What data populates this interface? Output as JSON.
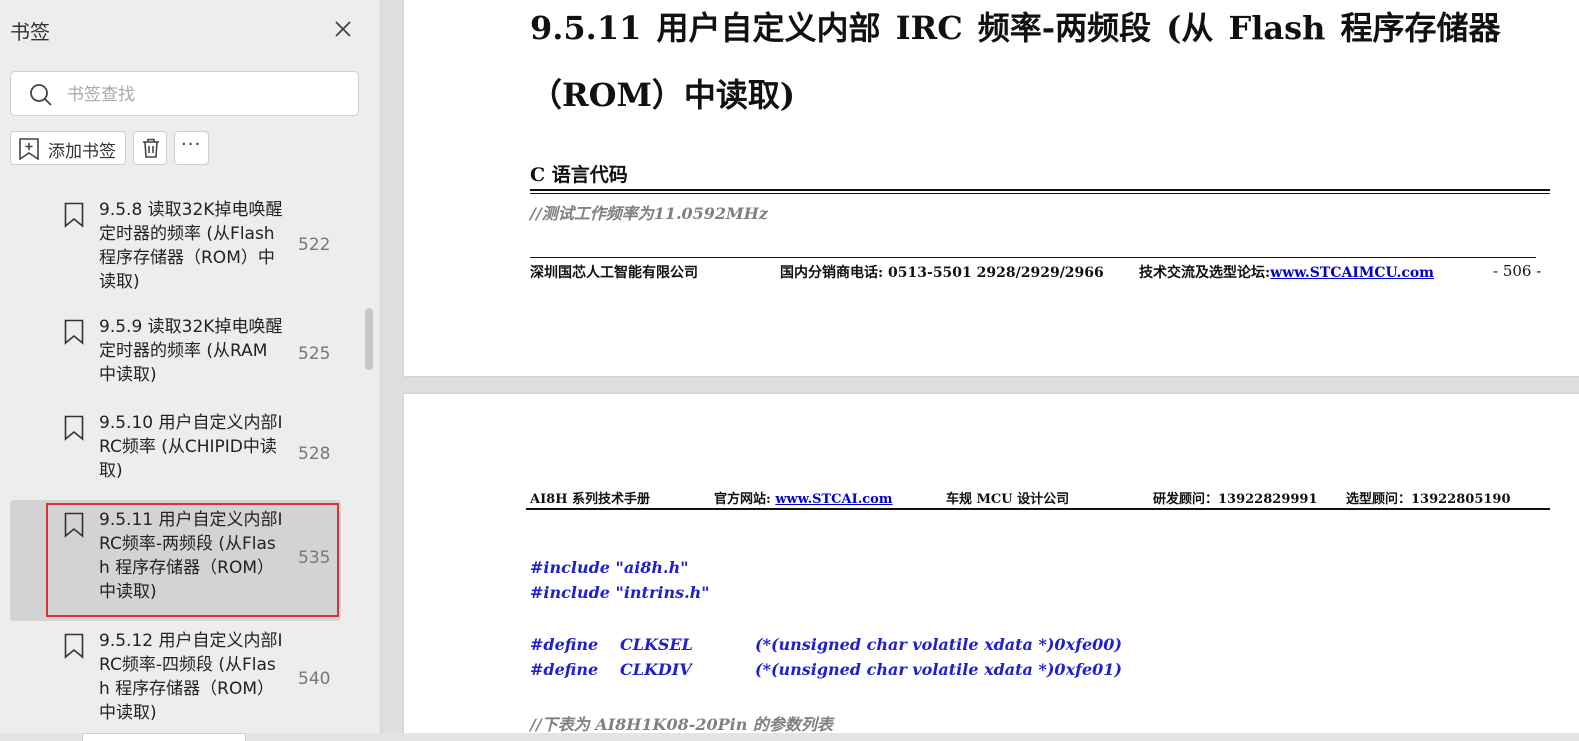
{
  "sidebar": {
    "title": "书签",
    "search": {
      "placeholder": "书签查找",
      "value": ""
    },
    "toolbar": {
      "add_label": "添加书签",
      "more_label": "···"
    },
    "bookmarks": [
      {
        "label": "9.5.8 读取32K掉电唤醒定时器的频率 (从Flash 程序存储器（ROM）中读取)",
        "lines": [
          "9.5.8 读取32K掉电唤醒",
          "定时器的频率 (从Flash",
          "程序存储器（ROM）中",
          "读取)"
        ],
        "page": "522",
        "selected": false
      },
      {
        "label": "9.5.9 读取32K掉电唤醒定时器的频率 (从RAM中读取)",
        "lines": [
          "9.5.9 读取32K掉电唤醒",
          "定时器的频率 (从RAM",
          "中读取)"
        ],
        "page": "525",
        "selected": false
      },
      {
        "label": "9.5.10 用户自定义内部IRC频率 (从CHIPID中读取)",
        "lines": [
          "9.5.10 用户自定义内部I",
          "RC频率 (从CHIPID中读",
          "取)"
        ],
        "page": "528",
        "selected": false
      },
      {
        "label": "9.5.11 用户自定义内部IRC频率-两频段 (从Flash 程序存储器（ROM）中读取)",
        "lines": [
          "9.5.11 用户自定义内部I",
          "RC频率-两频段 (从Flas",
          "h 程序存储器（ROM）",
          "中读取)"
        ],
        "page": "535",
        "selected": true
      },
      {
        "label": "9.5.12 用户自定义内部IRC频率-四频段 (从Flash 程序存储器（ROM）中读取)",
        "lines": [
          "9.5.12 用户自定义内部I",
          "RC频率-四频段 (从Flas",
          "h 程序存储器（ROM）",
          "中读取)"
        ],
        "page": "540",
        "selected": false
      }
    ]
  },
  "page1": {
    "heading_line1": "9.5.11  用户自定义内部  IRC  频率-两频段  (从  Flash  程序存储器",
    "heading_line2": "（ROM）中读取)",
    "section": "C 语言代码",
    "comment": "//测试工作频率为11.0592MHz",
    "footer": {
      "company": "深圳国芯人工智能有限公司",
      "phone": "国内分销商电话: 0513-5501 2928/2929/2966",
      "forum_label": "技术交流及选型论坛:",
      "forum_link": "www.STCAIMCU.com",
      "page_number": "- 506 -"
    }
  },
  "page2": {
    "header": {
      "manual": "AI8H 系列技术手册",
      "site_label": "官方网站: ",
      "site_link": "www.STCAI.com",
      "company": "车规 MCU 设计公司",
      "rd": "研发顾问：13922829991",
      "sel": "选型顾问：13922805190"
    },
    "code": {
      "include1": "#include \"ai8h.h\"",
      "include2": "#include \"intrins.h\"",
      "define1_kw": "#define",
      "define1_name": "CLKSEL",
      "define1_val": "(*(unsigned char volatile xdata *)0xfe00)",
      "define2_kw": "#define",
      "define2_name": "CLKDIV",
      "define2_val": "(*(unsigned char volatile xdata *)0xfe01)",
      "comment": "//下表为 AI8H1K08-20Pin 的参数列表"
    }
  },
  "colors": {
    "selection_outline": "#d6333a",
    "code_blue": "#2020cc",
    "comment_gray": "#808080",
    "link_blue": "#0000cc"
  }
}
